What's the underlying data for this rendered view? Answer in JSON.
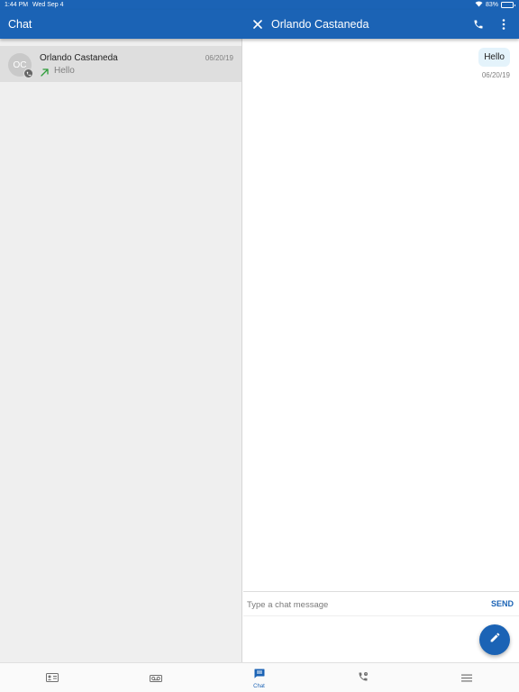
{
  "status_bar": {
    "time": "1:44 PM",
    "date": "Wed Sep 4",
    "battery": "83%",
    "battery_level": 0.83
  },
  "header": {
    "left_title": "Chat",
    "conversation_title": "Orlando Castaneda",
    "icons": [
      "close-icon",
      "phone-icon",
      "more-vert-icon"
    ]
  },
  "conversations": [
    {
      "initials": "OC",
      "name": "Orlando Castaneda",
      "date": "06/20/19",
      "preview": "Hello",
      "direction": "outgoing"
    }
  ],
  "messages": [
    {
      "text": "Hello",
      "date": "06/20/19",
      "direction": "outgoing"
    }
  ],
  "composer": {
    "placeholder": "Type a chat message",
    "send_label": "SEND"
  },
  "nav": {
    "items": [
      {
        "icon": "contacts-icon",
        "label": ""
      },
      {
        "icon": "voicemail-icon",
        "label": ""
      },
      {
        "icon": "chat-icon",
        "label": "Chat",
        "active": true
      },
      {
        "icon": "calls-icon",
        "label": ""
      },
      {
        "icon": "menu-icon",
        "label": ""
      }
    ]
  },
  "colors": {
    "primary": "#1b63b5",
    "bubble": "#e4f3fb",
    "list_bg": "#efefef",
    "selected_row": "#dedede",
    "outgoing_arrow": "#2e9d3a"
  }
}
